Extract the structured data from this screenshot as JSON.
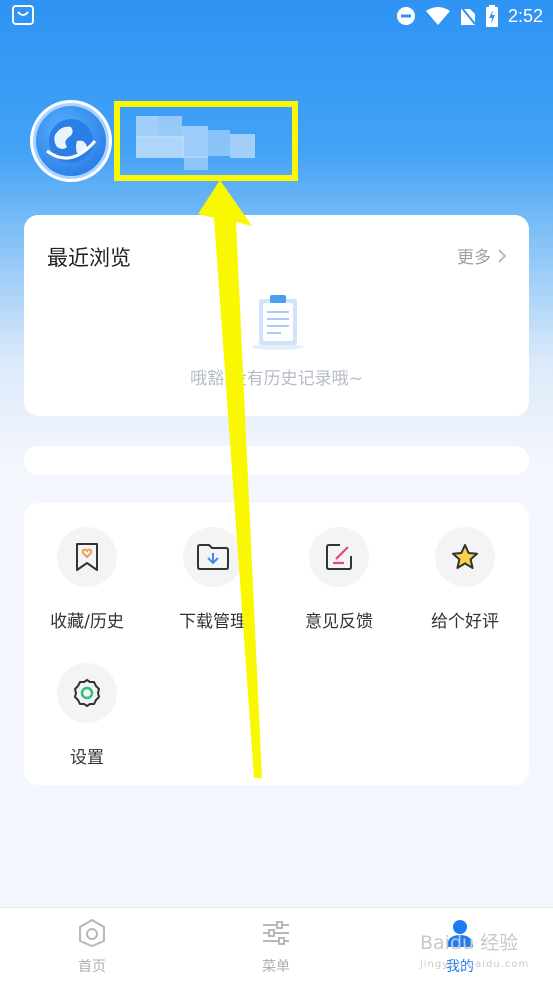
{
  "status_bar": {
    "time": "2:52"
  },
  "profile": {
    "username": ""
  },
  "recent": {
    "title": "最近浏览",
    "more_label": "更多",
    "empty_text": "哦豁,没有历史记录哦~"
  },
  "tools": [
    {
      "label": "收藏/历史",
      "icon": "bookmark-heart-icon"
    },
    {
      "label": "下载管理",
      "icon": "folder-download-icon"
    },
    {
      "label": "意见反馈",
      "icon": "edit-feedback-icon"
    },
    {
      "label": "给个好评",
      "icon": "star-icon"
    },
    {
      "label": "设置",
      "icon": "gear-icon"
    }
  ],
  "tabs": [
    {
      "label": "首页",
      "icon": "home-icon",
      "active": false
    },
    {
      "label": "菜单",
      "icon": "sliders-icon",
      "active": false
    },
    {
      "label": "我的",
      "icon": "user-icon",
      "active": true
    }
  ],
  "watermark": {
    "text": "Baidu 经验",
    "sub": "jingyan.baidu.com"
  },
  "colors": {
    "accent": "#1c7cf0",
    "highlight": "#f9f800",
    "header": "#2e93f3"
  }
}
